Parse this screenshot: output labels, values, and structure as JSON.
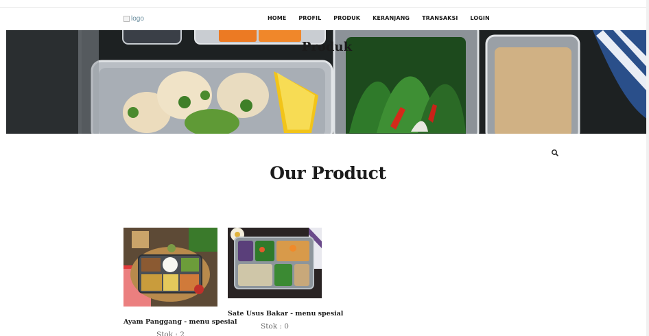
{
  "brand": {
    "logo_alt": "logo"
  },
  "nav": {
    "items": [
      {
        "label": "HOME"
      },
      {
        "label": "PROFIL"
      },
      {
        "label": "PRODUK"
      },
      {
        "label": "KERANJANG"
      },
      {
        "label": "TRANSAKSI"
      },
      {
        "label": "LOGIN"
      }
    ]
  },
  "hero": {
    "title": "Produk"
  },
  "search": {
    "icon": "search-icon"
  },
  "section": {
    "title": "Our Product"
  },
  "products": [
    {
      "name": "Ayam Panggang - menu spesial",
      "stock": "Stok : 2"
    },
    {
      "name": "Sate Usus Bakar - menu spesial",
      "stock": "Stok : 0"
    }
  ]
}
